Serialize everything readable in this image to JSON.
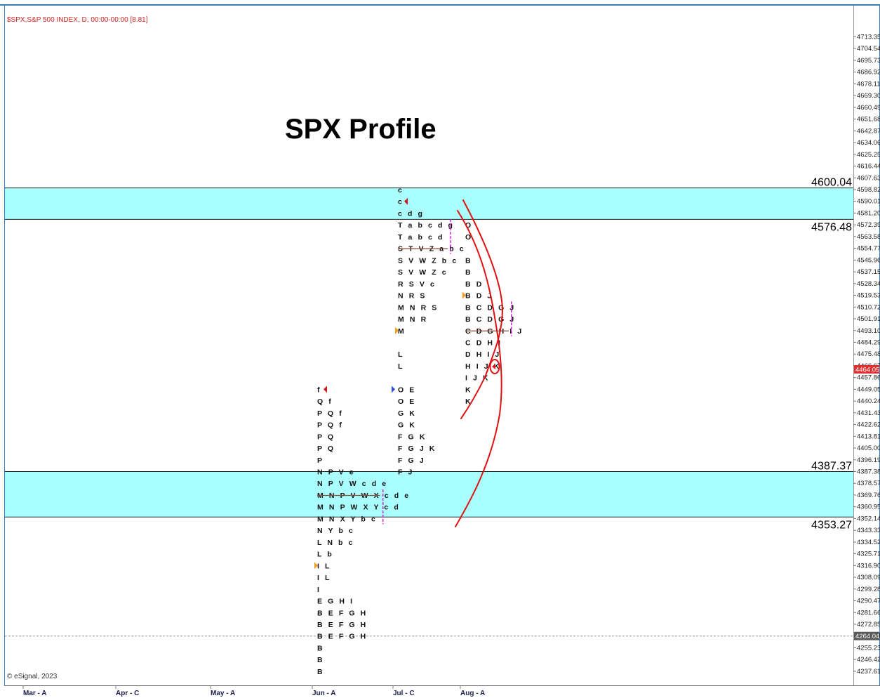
{
  "header": {
    "info": "$SPX,S&P 500 INDEX, D, 00:00-00:00  [8.81]",
    "title": "SPX Profile",
    "copyright": "© eSignal, 2023"
  },
  "colors": {
    "band": "#aaffff",
    "info_text": "#d21f1f",
    "annotation": "#e01010",
    "value_area": "#dd22dd",
    "poc_line": "#8a4a3a",
    "frame": "#3c7fc0",
    "price_tag": "#e03030",
    "price_tag_gray": "#5a5a5a"
  },
  "chart_data": {
    "type": "tpo_profile",
    "y_axis": {
      "range": [
        4237.61,
        4722.16
      ],
      "tick_step": 8.81,
      "ticks": [
        "4713.35",
        "4704.54",
        "4695.73",
        "4686.92",
        "4678.11",
        "4669.30",
        "4660.49",
        "4651.68",
        "4642.87",
        "4634.06",
        "4625.25",
        "4616.44",
        "4607.63",
        "4598.82",
        "4590.01",
        "4581.20",
        "4572.39",
        "4563.58",
        "4554.77",
        "4545.96",
        "4537.15",
        "4528.34",
        "4519.53",
        "4510.72",
        "4501.91",
        "4493.10",
        "4484.29",
        "4475.48",
        "4466.67",
        "4457.86",
        "4449.05",
        "4440.24",
        "4431.43",
        "4422.62",
        "4413.81",
        "4405.00",
        "4396.19",
        "4387.38",
        "4378.57",
        "4369.76",
        "4360.95",
        "4352.14",
        "4343.33",
        "4334.52",
        "4325.71",
        "4316.90",
        "4308.09",
        "4299.28",
        "4290.47",
        "4281.66",
        "4272.85",
        "4264.04",
        "4255.23",
        "4246.42",
        "4237.61"
      ],
      "current_price_tag": "4464.05",
      "highlight_tag": "4264.04"
    },
    "x_axis": {
      "labels": [
        {
          "label": "Mar - A",
          "date": "2023-03-01"
        },
        {
          "label": "Apr - C",
          "date": "2023-04-01"
        },
        {
          "label": "May - A",
          "date": "2023-05-01"
        },
        {
          "label": "Jun - A",
          "date": "2023-06-01"
        },
        {
          "label": "Jul - C",
          "date": "2023-07-01"
        },
        {
          "label": "Aug - A",
          "date": "2023-08-01"
        }
      ]
    },
    "bands": [
      {
        "top": 4600.04,
        "bottom": 4576.48,
        "top_label": "4600.04",
        "bottom_label": "4576.48"
      },
      {
        "top": 4387.37,
        "bottom": 4353.27,
        "top_label": "4387.37",
        "bottom_label": "4353.27"
      }
    ],
    "profiles": [
      {
        "month": "Jun",
        "rows": [
          {
            "price": 4449.05,
            "text": "f"
          },
          {
            "price": 4440.24,
            "text": "Q f"
          },
          {
            "price": 4431.43,
            "text": "P Q f"
          },
          {
            "price": 4422.62,
            "text": "P Q f"
          },
          {
            "price": 4413.81,
            "text": "P Q"
          },
          {
            "price": 4405.0,
            "text": "P Q"
          },
          {
            "price": 4396.19,
            "text": "P"
          },
          {
            "price": 4387.38,
            "text": "N P V e"
          },
          {
            "price": 4378.57,
            "text": "N P V W c d e"
          },
          {
            "price": 4369.76,
            "text": "M N P V W X c d e"
          },
          {
            "price": 4360.95,
            "text": "M N P W X Y c d"
          },
          {
            "price": 4352.14,
            "text": "M N X Y b c"
          },
          {
            "price": 4343.33,
            "text": "N Y b c"
          },
          {
            "price": 4334.52,
            "text": "L N b c"
          },
          {
            "price": 4325.71,
            "text": "L b"
          },
          {
            "price": 4316.9,
            "text": "I L"
          },
          {
            "price": 4308.09,
            "text": "I L"
          },
          {
            "price": 4299.28,
            "text": "I"
          },
          {
            "price": 4290.47,
            "text": "E G H I"
          },
          {
            "price": 4281.66,
            "text": "B E F G H"
          },
          {
            "price": 4272.85,
            "text": "B E F G H"
          },
          {
            "price": 4264.04,
            "text": "B E F G H"
          },
          {
            "price": 4255.23,
            "text": "B"
          },
          {
            "price": 4246.42,
            "text": "B"
          },
          {
            "price": 4237.61,
            "text": "B"
          }
        ],
        "poc": 4369.76,
        "value_area": [
          4352.14,
          4369.76
        ]
      },
      {
        "month": "Jul",
        "rows": [
          {
            "price": 4598.82,
            "text": "c"
          },
          {
            "price": 4590.01,
            "text": "c"
          },
          {
            "price": 4581.2,
            "text": "c d g"
          },
          {
            "price": 4572.39,
            "text": "T a b c d g"
          },
          {
            "price": 4563.58,
            "text": "T a b c d"
          },
          {
            "price": 4554.77,
            "text": "S T V Z a b c"
          },
          {
            "price": 4545.96,
            "text": "S V W Z b c"
          },
          {
            "price": 4537.15,
            "text": "S V W Z c"
          },
          {
            "price": 4528.34,
            "text": "R S V c"
          },
          {
            "price": 4519.53,
            "text": "N R S"
          },
          {
            "price": 4510.72,
            "text": "M N R S"
          },
          {
            "price": 4501.91,
            "text": "M N R"
          },
          {
            "price": 4493.1,
            "text": "M"
          },
          {
            "price": 4475.48,
            "text": "L"
          },
          {
            "price": 4466.67,
            "text": "L"
          },
          {
            "price": 4449.05,
            "text": "O E"
          },
          {
            "price": 4440.24,
            "text": "O E"
          },
          {
            "price": 4431.43,
            "text": "G K"
          },
          {
            "price": 4422.62,
            "text": "G K"
          },
          {
            "price": 4413.81,
            "text": "F G K"
          },
          {
            "price": 4405.0,
            "text": "F G J K"
          },
          {
            "price": 4396.19,
            "text": "F G J"
          },
          {
            "price": 4387.38,
            "text": "F J"
          }
        ],
        "poc": 4554.77,
        "value_area": [
          4554.77,
          4572.39
        ]
      },
      {
        "month": "Aug",
        "rows": [
          {
            "price": 4572.39,
            "text": "O"
          },
          {
            "price": 4563.58,
            "text": "O"
          },
          {
            "price": 4545.96,
            "text": "B"
          },
          {
            "price": 4537.15,
            "text": "B"
          },
          {
            "price": 4528.34,
            "text": "B D"
          },
          {
            "price": 4519.53,
            "text": "B D J"
          },
          {
            "price": 4510.72,
            "text": "B C D G J"
          },
          {
            "price": 4501.91,
            "text": "B C D G J"
          },
          {
            "price": 4493.1,
            "text": "C D G H I J"
          },
          {
            "price": 4484.29,
            "text": "C D H I"
          },
          {
            "price": 4475.48,
            "text": "D H I J"
          },
          {
            "price": 4466.67,
            "text": "H I J K"
          },
          {
            "price": 4457.86,
            "text": "I J K"
          },
          {
            "price": 4449.05,
            "text": "K"
          },
          {
            "price": 4440.24,
            "text": "K"
          }
        ],
        "poc": 4493.1,
        "value_area": [
          4493.1,
          4510.72
        ]
      }
    ]
  }
}
